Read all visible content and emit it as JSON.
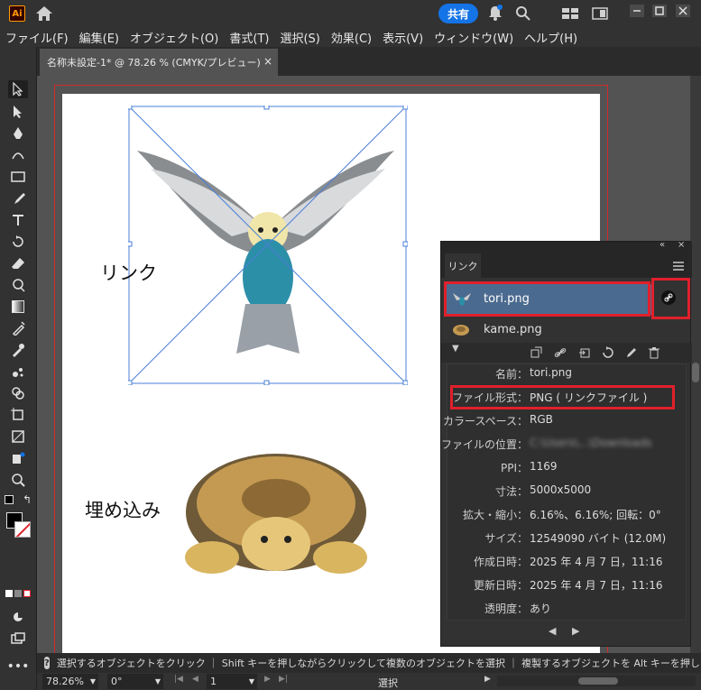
{
  "app": {
    "logo_text": "Ai",
    "share_label": "共有"
  },
  "menu": [
    "ファイル(F)",
    "編集(E)",
    "オブジェクト(O)",
    "書式(T)",
    "選択(S)",
    "効果(C)",
    "表示(V)",
    "ウィンドウ(W)",
    "ヘルプ(H)"
  ],
  "document_tab": {
    "title": "名称未設定-1* @ 78.26 % (CMYK/プレビュー)",
    "close": "×"
  },
  "canvas": {
    "label_link": "リンク",
    "label_embed": "埋め込み"
  },
  "links_panel": {
    "tab_label": "リンク",
    "items": [
      {
        "name": "tori.png",
        "selected": true
      },
      {
        "name": "kame.png",
        "selected": false
      }
    ],
    "info": [
      {
        "label": "名前：",
        "value": "tori.png"
      },
      {
        "label": "ファイル形式：",
        "value": "PNG ( リンクファイル )"
      },
      {
        "label": "カラースペース：",
        "value": "RGB"
      },
      {
        "label": "ファイルの位置：",
        "value": "C:\\Users\\...\\Downloads"
      },
      {
        "label": "PPI：",
        "value": "1169"
      },
      {
        "label": "寸法：",
        "value": "5000x5000"
      },
      {
        "label": "拡大・縮小：",
        "value": "6.16%、6.16%; 回転：0°"
      },
      {
        "label": "サイズ：",
        "value": "12549090 バイト (12.0M)"
      },
      {
        "label": "作成日時：",
        "value": "2025 年 4 月 7 日，11:16"
      },
      {
        "label": "更新日時：",
        "value": "2025 年 4 月 7 日，11:16"
      },
      {
        "label": "透明度：",
        "value": "あり"
      }
    ]
  },
  "status": {
    "hint": "選択するオブジェクトをクリック ｜ Shift キーを押しながらクリックして複数のオブジェクトを選択 ｜ 複製するオブジェクトを Alt キーを押しながら",
    "zoom": "78.26%",
    "rotation": "0°",
    "page": "1",
    "mode": "選択"
  },
  "colors": {
    "accent": "#1473e6",
    "highlight_red": "#e0202b",
    "selected_row": "#4b6a8f"
  }
}
